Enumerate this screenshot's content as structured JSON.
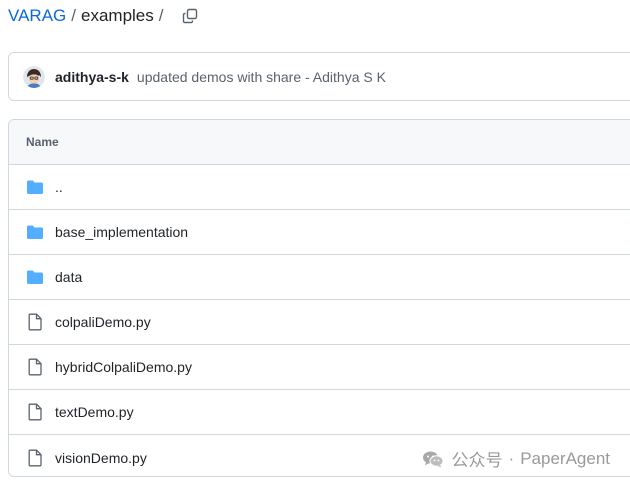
{
  "breadcrumb": {
    "repo": "VARAG",
    "separator": "/",
    "directory": "examples"
  },
  "commit": {
    "author": "adithya-s-k",
    "message": "updated demos with share - Adithya S K"
  },
  "table": {
    "header": "Name",
    "rows": [
      {
        "name": "..",
        "icon": "folder-icon"
      },
      {
        "name": "base_implementation",
        "icon": "folder-icon"
      },
      {
        "name": "data",
        "icon": "folder-icon"
      },
      {
        "name": "colpaliDemo.py",
        "icon": "file-icon"
      },
      {
        "name": "hybridColpaliDemo.py",
        "icon": "file-icon"
      },
      {
        "name": "textDemo.py",
        "icon": "file-icon"
      },
      {
        "name": "visionDemo.py",
        "icon": "file-icon"
      }
    ]
  },
  "watermark": {
    "source": "公众号",
    "separator": "·",
    "name": "PaperAgent"
  },
  "colors": {
    "link": "#0969da",
    "folder": "#54aeff",
    "border": "#d1d9e0",
    "header_bg": "#f6f8fa"
  }
}
